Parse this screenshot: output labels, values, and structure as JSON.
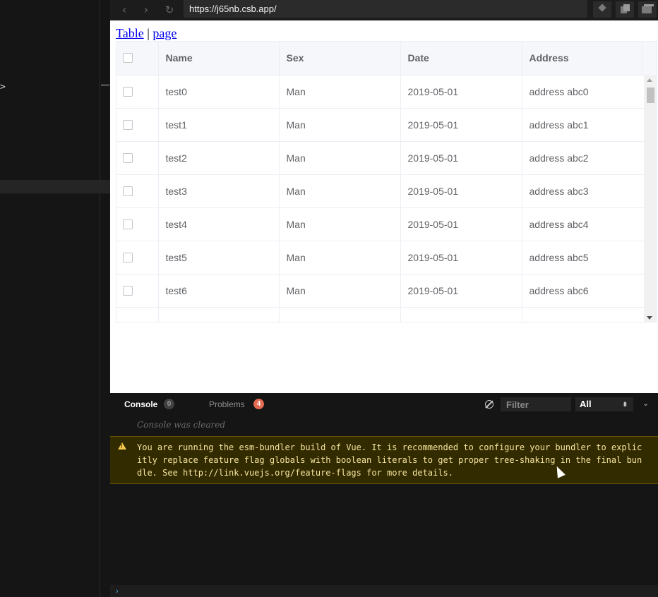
{
  "browser": {
    "url": "https://j65nb.csb.app/",
    "back_icon": "chevron-left-icon",
    "forward_icon": "chevron-right-icon",
    "reload_icon": "reload-icon"
  },
  "editor": {
    "left_arrow": ">"
  },
  "page": {
    "link_table": "Table",
    "separator": " | ",
    "link_page": "page"
  },
  "table": {
    "columns": [
      "Name",
      "Sex",
      "Date",
      "Address"
    ],
    "rows": [
      {
        "name": "test0",
        "sex": "Man",
        "date": "2019-05-01",
        "address": "address abc0"
      },
      {
        "name": "test1",
        "sex": "Man",
        "date": "2019-05-01",
        "address": "address abc1"
      },
      {
        "name": "test2",
        "sex": "Man",
        "date": "2019-05-01",
        "address": "address abc2"
      },
      {
        "name": "test3",
        "sex": "Man",
        "date": "2019-05-01",
        "address": "address abc3"
      },
      {
        "name": "test4",
        "sex": "Man",
        "date": "2019-05-01",
        "address": "address abc4"
      },
      {
        "name": "test5",
        "sex": "Man",
        "date": "2019-05-01",
        "address": "address abc5"
      },
      {
        "name": "test6",
        "sex": "Man",
        "date": "2019-05-01",
        "address": "address abc6"
      }
    ]
  },
  "console": {
    "tab_console": "Console",
    "console_count": "0",
    "tab_problems": "Problems",
    "problems_count": "4",
    "filter_placeholder": "Filter",
    "level": "All",
    "cleared_text": "Console was cleared",
    "warning_text": "You are running the esm-bundler build of Vue. It is recommended to configure your bundler to explicitly replace feature flag globals with boolean literals to get proper tree-shaking in the final bundle. See http://link.vuejs.org/feature-flags for more details.",
    "prompt": "›"
  },
  "colors": {
    "warning_bg": "#332b00",
    "warning_text": "#f5e5a0",
    "link": "#0000ee",
    "problems_badge": "#e36b52"
  }
}
